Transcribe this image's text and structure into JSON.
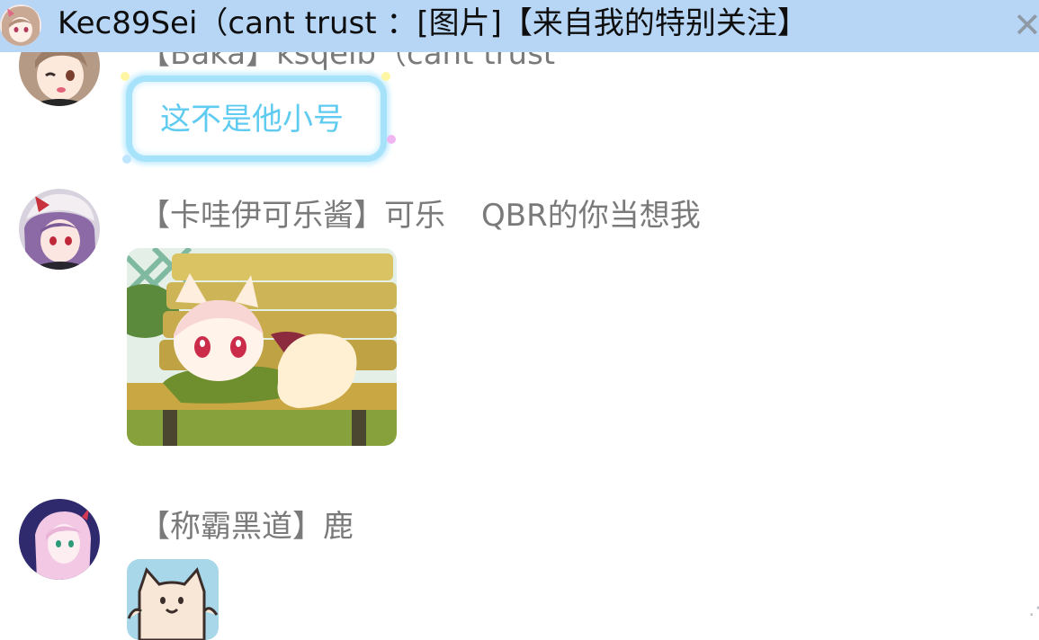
{
  "notification": {
    "text": "Kec89Sei（cant trust ：[图片]【来自我的特别关注】",
    "avatar_icon": "anime-girl-avatar",
    "close_icon": "close-x-icon",
    "background": "#b7d6f6"
  },
  "messages": [
    {
      "sender": "【Baka】ksqeib（cant trust",
      "avatar_icon": "anime-girl-winking-avatar",
      "bubble_text": "这不是他小号"
    },
    {
      "sender_tag": "【卡哇伊可乐酱】可乐",
      "sender_title": "QBR的你当想我",
      "avatar_icon": "purple-hair-girl-avatar",
      "image_icon": "fox-girl-on-bench-sticker"
    },
    {
      "sender": "【称霸黑道】鹿",
      "avatar_icon": "pink-hair-girl-avatar",
      "image_icon": "cream-cat-sticker"
    }
  ],
  "colors": {
    "sender_text": "#7a7a7a",
    "bubble_text": "#5fcbf0",
    "bubble_border": "#a7e2fb"
  }
}
